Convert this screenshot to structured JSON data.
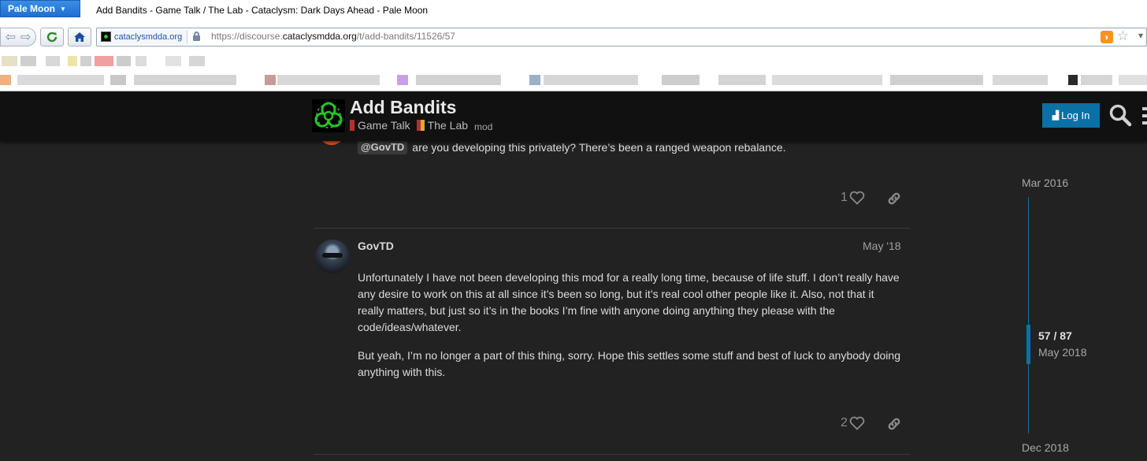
{
  "browser": {
    "app_button": "Pale Moon",
    "window_title": "Add Bandits - Game Talk / The Lab - Cataclysm: Dark Days Ahead - Pale Moon",
    "identity_domain": "cataclysmdda.org",
    "url_prefix": "https://discourse.",
    "url_domain": "cataclysmdda.org",
    "url_path": "/t/add-bandits/11526/57"
  },
  "header": {
    "topic_title": "Add Bandits",
    "categories": [
      {
        "label": "Game Talk",
        "color": "#b62f2f"
      },
      {
        "label": "The Lab",
        "color": "#b62f2f"
      }
    ],
    "tag": "mod",
    "login_label": "Log In"
  },
  "posts": [
    {
      "mention": "@GovTD",
      "text": "are you developing this privately? There’s been a ranged weapon rebalance.",
      "likes": "1"
    },
    {
      "username": "GovTD",
      "date": "May '18",
      "paragraphs": [
        "Unfortunately I have not been developing this mod for a really long time, because of life stuff. I don’t really have any desire to work on this at all since it’s been so long, but it’s real cool other people like it. Also, not that it really matters, but just so it’s in the books I’m fine with anyone doing anything they please with the code/ideas/whatever.",
        "But yeah, I’m no longer a part of this thing, sorry. Hope this settles some stuff and best of luck to anybody doing anything with this."
      ],
      "likes": "2"
    }
  ],
  "timeline": {
    "start": "Mar 2016",
    "position": "57 / 87",
    "current_date": "May 2018",
    "end": "Dec 2018"
  },
  "colors": {
    "accent": "#0a71a5",
    "background": "#222222",
    "header": "#111111"
  }
}
